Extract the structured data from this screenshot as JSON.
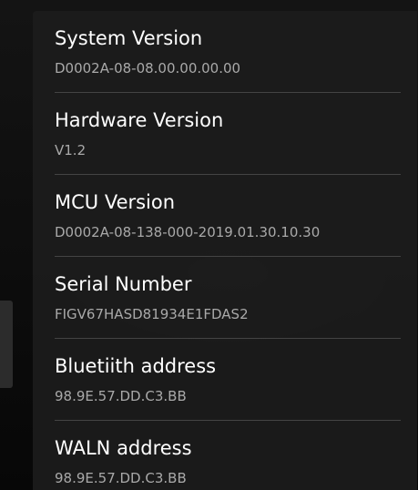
{
  "about": {
    "items": [
      {
        "title": "System Version",
        "value": "D0002A-08-08.00.00.00.00"
      },
      {
        "title": "Hardware Version",
        "value": "V1.2"
      },
      {
        "title": "MCU Version",
        "value": "D0002A-08-138-000-2019.01.30.10.30"
      },
      {
        "title": "Serial Number",
        "value": "FIGV67HASD81934E1FDAS2"
      },
      {
        "title": "Bluetiith address",
        "value": "98.9E.57.DD.C3.BB"
      },
      {
        "title": "WALN address",
        "value": "98.9E.57.DD.C3.BB"
      }
    ]
  },
  "colors": {
    "background": "#0b0b0b",
    "panel": "#1c1c1c",
    "title_text": "#ffffff",
    "value_text": "#a9a9a9",
    "divider": "#444444"
  }
}
